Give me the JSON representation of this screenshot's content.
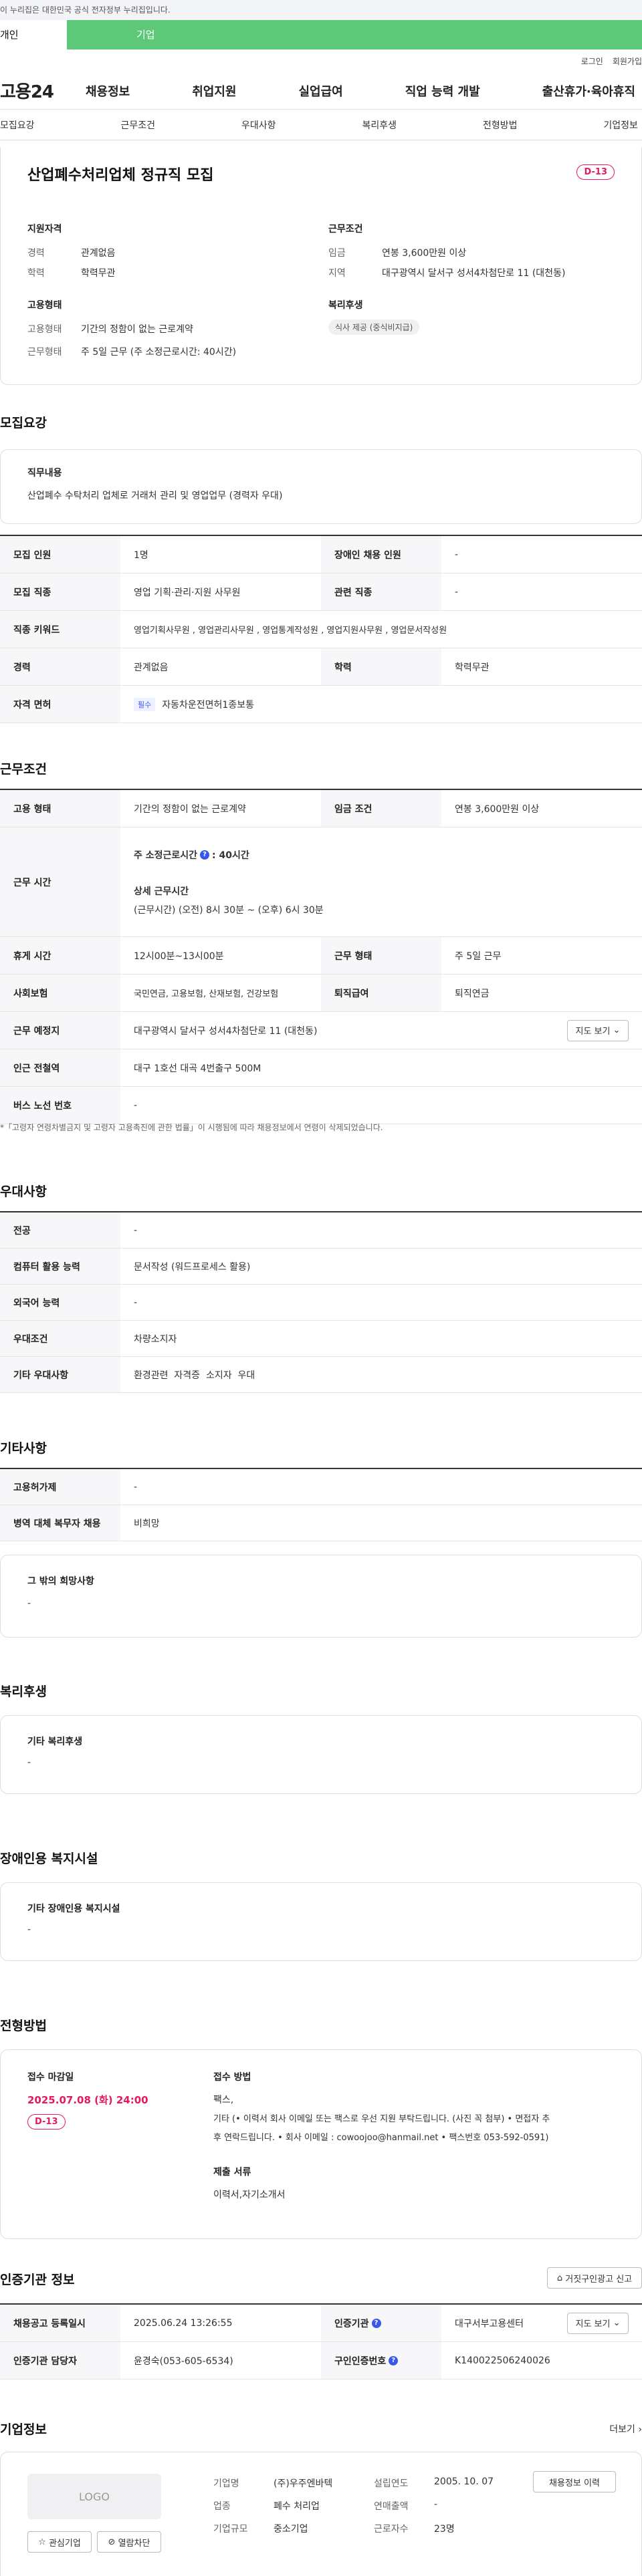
{
  "gov_banner": "이 누리집은 대한민국 공식 전자정부 누리집입니다.",
  "user_tabs": [
    "개인",
    "기업"
  ],
  "util": [
    "로그인",
    "회원가입"
  ],
  "logo": "고용24",
  "gnb": [
    "채용정보",
    "취업지원",
    "실업급여",
    "직업 능력 개발",
    "출산휴가·육아휴직"
  ],
  "subtabs": [
    "모집요강",
    "근무조건",
    "우대사항",
    "복리후생",
    "전형방법",
    "기업정보"
  ],
  "summary": {
    "title": "산업폐수처리업체 정규직 모집",
    "dday": "D-13",
    "qual_heading": "지원자격",
    "qual": [
      {
        "label": "경력",
        "value": "관계없음"
      },
      {
        "label": "학력",
        "value": "학력무관"
      }
    ],
    "cond_heading": "근무조건",
    "cond": [
      {
        "label": "임금",
        "value": "연봉 3,600만원 이상"
      },
      {
        "label": "지역",
        "value": "대구광역시 달서구 성서4차첨단로 11 (대천동)"
      }
    ],
    "emp_heading": "고용형태",
    "emp": [
      {
        "label": "고용형태",
        "value": "기간의 정함이 없는 근로계약"
      },
      {
        "label": "근무형태",
        "value": "주 5일 근무 (주 소정근로시간: 40시간)"
      }
    ],
    "welfare_heading": "복리후생",
    "welfare_chip": "식사 제공 (중식비지급)"
  },
  "recruit": {
    "heading": "모집요강",
    "duty_label": "직무내용",
    "duty": "산업폐수 수탁처리 업체로 거래처 관리 및 영업업무 (경력자 우대)",
    "rows": {
      "r1": {
        "k1": "모집 인원",
        "v1": "1명",
        "k2": "장애인 채용 인원",
        "v2": "-"
      },
      "r2": {
        "k1": "모집 직종",
        "v1": "영업 기획·관리·지원 사무원",
        "k2": "관련 직종",
        "v2": "-"
      },
      "r3": {
        "k1": "직종 키워드",
        "v1": "영업기획사무원 , 영업관리사무원 , 영업통계작성원 , 영업지원사무원 , 영업문서작성원"
      },
      "r4": {
        "k1": "경력",
        "v1": "관계없음",
        "k2": "학력",
        "v2": "학력무관"
      },
      "r5": {
        "k1": "자격 면허",
        "tag": "필수",
        "v1": "자동차운전면허1종보통"
      }
    }
  },
  "work": {
    "heading": "근무조건",
    "r1": {
      "k1": "고용 형태",
      "v1": "기간의 정함이 없는 근로계약",
      "k2": "임금 조건",
      "v2": "연봉 3,600만원 이상"
    },
    "time": {
      "k": "근무 시간",
      "week_label": "주 소정근로시간",
      "week_value": ": 40시간",
      "detail_label": "상세 근무시간",
      "detail_value": "(근무시간) (오전) 8시 30분 ~ (오후) 6시 30분"
    },
    "r3": {
      "k1": "휴게 시간",
      "v1": "12시00분~13시00분",
      "k2": "근무 형태",
      "v2": "주 5일 근무"
    },
    "r4": {
      "k1": "사회보험",
      "v1": "국민연금, 고용보험, 산재보험, 건강보험",
      "k2": "퇴직급여",
      "v2": "퇴직연금"
    },
    "r5": {
      "k1": "근무 예정지",
      "v1": "대구광역시 달서구 성서4차첨단로 11 (대천동)",
      "btn": "지도 보기"
    },
    "r6": {
      "k1": "인근 전철역",
      "v1": "대구 1호선 대곡 4번출구 500M"
    },
    "r7": {
      "k1": "버스 노선 번호",
      "v1": "-"
    },
    "note": "*「고령자 연령차별금지 및 고령자 고용촉진에 관한 법률」이 시행됨에 따라 채용정보에서 연령이 삭제되었습니다."
  },
  "pref": {
    "heading": "우대사항",
    "rows": [
      {
        "k": "전공",
        "v": "-"
      },
      {
        "k": "컴퓨터 활용 능력",
        "v": "문서작성 (워드프로세스 활용)"
      },
      {
        "k": "외국어 능력",
        "v": "-"
      },
      {
        "k": "우대조건",
        "v": "차량소지자"
      },
      {
        "k": "기타 우대사항",
        "v": "환경관련  자격증  소지자  우대"
      }
    ]
  },
  "etc": {
    "heading": "기타사항",
    "rows": [
      {
        "k": "고용허가제",
        "v": "-"
      },
      {
        "k": "병역 대체 복무자 채용",
        "v": "비희망"
      }
    ],
    "wish_label": "그 밖의 희망사항",
    "wish_value": "-"
  },
  "welfare": {
    "heading": "복리후생",
    "label": "기타 복리후생",
    "value": "-"
  },
  "disabled": {
    "heading": "장애인용 복지시설",
    "label": "기타 장애인용 복지시설",
    "value": "-"
  },
  "selection": {
    "heading": "전형방법",
    "deadline_label": "접수 마감일",
    "deadline": "2025.07.08 (화) 24:00",
    "dday": "D-13",
    "method_label": "접수 방법",
    "method1": "팩스,",
    "method2": "기타 (• 이력서  회사 이메일 또는 팩스로 우선 지원 부탁드립니다. (사진 꼭 첨부) • 면접자 추",
    "method3": "후 연락드립니다. • 회사 이메일 : cowoojoo@hanmail.net • 팩스번호 053-592-0591)",
    "docs_label": "제출 서류",
    "docs": "이력서,자기소개서"
  },
  "cert": {
    "heading": "인증기관 정보",
    "report_btn": "거짓구인광고 신고",
    "r1": {
      "k1": "채용공고 등록일시",
      "v1": "2025.06.24 13:26:55",
      "k2": "인증기관",
      "v2": "대구서부고용센터",
      "btn": "지도 보기"
    },
    "r2": {
      "k1": "인증기관 담당자",
      "v1": "윤경숙(053-605-6534)",
      "k2": "구인인증번호",
      "v2": "K140022506240026"
    }
  },
  "company": {
    "heading": "기업정보",
    "more": "더보기",
    "logo": "LOGO",
    "fav_btn": "관심기업",
    "block_btn": "열람차단",
    "list_btn": "채용정보 이력",
    "left": [
      {
        "k": "기업명",
        "v": "(주)우주엔바텍"
      },
      {
        "k": "업종",
        "v": "폐수 처리업"
      },
      {
        "k": "기업규모",
        "v": "중소기업"
      }
    ],
    "right": [
      {
        "k": "설립연도",
        "v": "2005. 10. 07"
      },
      {
        "k": "연매출액",
        "v": "-"
      },
      {
        "k": "근로자수",
        "v": "23명"
      }
    ]
  }
}
